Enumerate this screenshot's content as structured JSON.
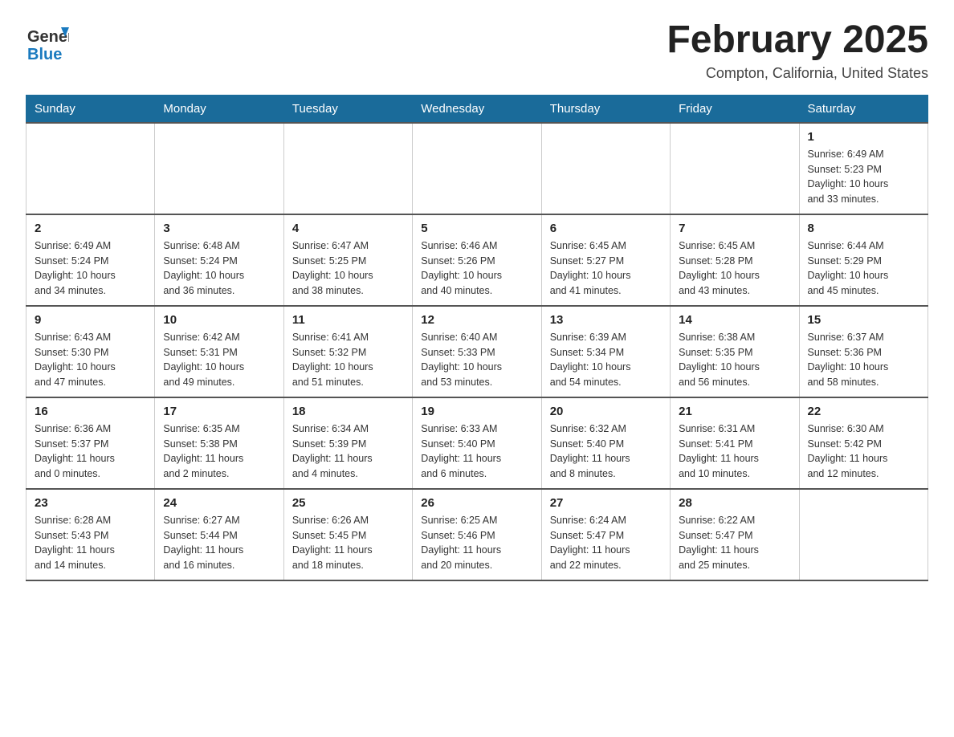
{
  "header": {
    "logo": {
      "general": "General",
      "blue": "Blue"
    },
    "title": "February 2025",
    "location": "Compton, California, United States"
  },
  "days_of_week": [
    "Sunday",
    "Monday",
    "Tuesday",
    "Wednesday",
    "Thursday",
    "Friday",
    "Saturday"
  ],
  "weeks": [
    [
      {
        "day": "",
        "info": ""
      },
      {
        "day": "",
        "info": ""
      },
      {
        "day": "",
        "info": ""
      },
      {
        "day": "",
        "info": ""
      },
      {
        "day": "",
        "info": ""
      },
      {
        "day": "",
        "info": ""
      },
      {
        "day": "1",
        "info": "Sunrise: 6:49 AM\nSunset: 5:23 PM\nDaylight: 10 hours\nand 33 minutes."
      }
    ],
    [
      {
        "day": "2",
        "info": "Sunrise: 6:49 AM\nSunset: 5:24 PM\nDaylight: 10 hours\nand 34 minutes."
      },
      {
        "day": "3",
        "info": "Sunrise: 6:48 AM\nSunset: 5:24 PM\nDaylight: 10 hours\nand 36 minutes."
      },
      {
        "day": "4",
        "info": "Sunrise: 6:47 AM\nSunset: 5:25 PM\nDaylight: 10 hours\nand 38 minutes."
      },
      {
        "day": "5",
        "info": "Sunrise: 6:46 AM\nSunset: 5:26 PM\nDaylight: 10 hours\nand 40 minutes."
      },
      {
        "day": "6",
        "info": "Sunrise: 6:45 AM\nSunset: 5:27 PM\nDaylight: 10 hours\nand 41 minutes."
      },
      {
        "day": "7",
        "info": "Sunrise: 6:45 AM\nSunset: 5:28 PM\nDaylight: 10 hours\nand 43 minutes."
      },
      {
        "day": "8",
        "info": "Sunrise: 6:44 AM\nSunset: 5:29 PM\nDaylight: 10 hours\nand 45 minutes."
      }
    ],
    [
      {
        "day": "9",
        "info": "Sunrise: 6:43 AM\nSunset: 5:30 PM\nDaylight: 10 hours\nand 47 minutes."
      },
      {
        "day": "10",
        "info": "Sunrise: 6:42 AM\nSunset: 5:31 PM\nDaylight: 10 hours\nand 49 minutes."
      },
      {
        "day": "11",
        "info": "Sunrise: 6:41 AM\nSunset: 5:32 PM\nDaylight: 10 hours\nand 51 minutes."
      },
      {
        "day": "12",
        "info": "Sunrise: 6:40 AM\nSunset: 5:33 PM\nDaylight: 10 hours\nand 53 minutes."
      },
      {
        "day": "13",
        "info": "Sunrise: 6:39 AM\nSunset: 5:34 PM\nDaylight: 10 hours\nand 54 minutes."
      },
      {
        "day": "14",
        "info": "Sunrise: 6:38 AM\nSunset: 5:35 PM\nDaylight: 10 hours\nand 56 minutes."
      },
      {
        "day": "15",
        "info": "Sunrise: 6:37 AM\nSunset: 5:36 PM\nDaylight: 10 hours\nand 58 minutes."
      }
    ],
    [
      {
        "day": "16",
        "info": "Sunrise: 6:36 AM\nSunset: 5:37 PM\nDaylight: 11 hours\nand 0 minutes."
      },
      {
        "day": "17",
        "info": "Sunrise: 6:35 AM\nSunset: 5:38 PM\nDaylight: 11 hours\nand 2 minutes."
      },
      {
        "day": "18",
        "info": "Sunrise: 6:34 AM\nSunset: 5:39 PM\nDaylight: 11 hours\nand 4 minutes."
      },
      {
        "day": "19",
        "info": "Sunrise: 6:33 AM\nSunset: 5:40 PM\nDaylight: 11 hours\nand 6 minutes."
      },
      {
        "day": "20",
        "info": "Sunrise: 6:32 AM\nSunset: 5:40 PM\nDaylight: 11 hours\nand 8 minutes."
      },
      {
        "day": "21",
        "info": "Sunrise: 6:31 AM\nSunset: 5:41 PM\nDaylight: 11 hours\nand 10 minutes."
      },
      {
        "day": "22",
        "info": "Sunrise: 6:30 AM\nSunset: 5:42 PM\nDaylight: 11 hours\nand 12 minutes."
      }
    ],
    [
      {
        "day": "23",
        "info": "Sunrise: 6:28 AM\nSunset: 5:43 PM\nDaylight: 11 hours\nand 14 minutes."
      },
      {
        "day": "24",
        "info": "Sunrise: 6:27 AM\nSunset: 5:44 PM\nDaylight: 11 hours\nand 16 minutes."
      },
      {
        "day": "25",
        "info": "Sunrise: 6:26 AM\nSunset: 5:45 PM\nDaylight: 11 hours\nand 18 minutes."
      },
      {
        "day": "26",
        "info": "Sunrise: 6:25 AM\nSunset: 5:46 PM\nDaylight: 11 hours\nand 20 minutes."
      },
      {
        "day": "27",
        "info": "Sunrise: 6:24 AM\nSunset: 5:47 PM\nDaylight: 11 hours\nand 22 minutes."
      },
      {
        "day": "28",
        "info": "Sunrise: 6:22 AM\nSunset: 5:47 PM\nDaylight: 11 hours\nand 25 minutes."
      },
      {
        "day": "",
        "info": ""
      }
    ]
  ]
}
